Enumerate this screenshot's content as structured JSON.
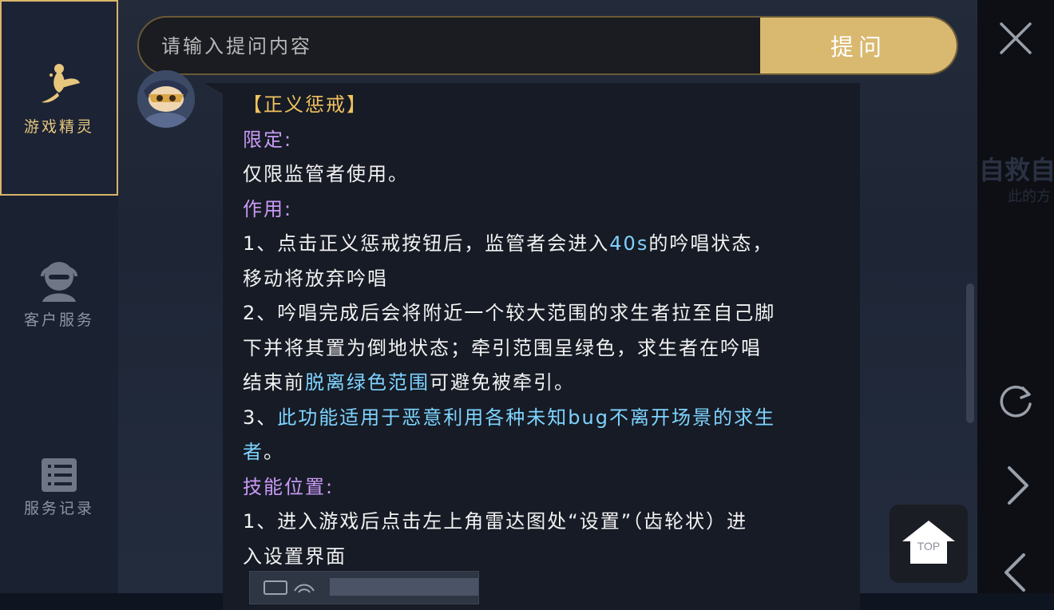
{
  "sidebar": {
    "items": [
      {
        "label": "游戏精灵",
        "icon": "fairy-icon",
        "active": true
      },
      {
        "label": "客户服务",
        "icon": "headset-agent-icon",
        "active": false
      },
      {
        "label": "服务记录",
        "icon": "list-record-icon",
        "active": false
      }
    ]
  },
  "search": {
    "placeholder": "请输入提问内容",
    "value": "",
    "button_label": "提问"
  },
  "answer": {
    "title": "【正义惩戒】",
    "section1_heading": "限定:",
    "section1_text": "仅限监管者使用。",
    "section2_heading": "作用:",
    "item1_pre": "1、点击正义惩戒按钮后，监管者会进入",
    "item1_hl": "40s",
    "item1_post": "的吟唱状态，",
    "item1_line2": "移动将放弃吟唱",
    "item2_line1": "2、吟唱完成后会将附近一个较大范围的求生者拉至自己脚",
    "item2_line2": "下并将其置为倒地状态；牵引范围呈绿色，求生者在吟唱",
    "item2_line3_pre": "结束前",
    "item2_line3_hl": "脱离绿色范围",
    "item2_line3_post": "可避免被牵引。",
    "item3_prefix": "3、",
    "item3_hl1": "此功能适用于恶意利用各种未知bug不离开场景的求生",
    "item3_hl2": "者",
    "item3_end": "。",
    "section3_heading": "技能位置:",
    "step1_line1": "1、进入游戏后点击左上角雷达图处“设置”（齿轮状）进",
    "step1_line2": "入设置界面"
  },
  "top_button": {
    "label": "TOP"
  },
  "background_text": {
    "line1": "自救自",
    "line2": "此的方"
  },
  "colors": {
    "accent_gold": "#d9b86f",
    "title_orange": "#f0c15e",
    "heading_purple": "#c89af5",
    "highlight_blue": "#7fd3ff"
  },
  "right_controls": [
    "close-icon",
    "refresh-icon",
    "forward-icon",
    "back-icon"
  ]
}
